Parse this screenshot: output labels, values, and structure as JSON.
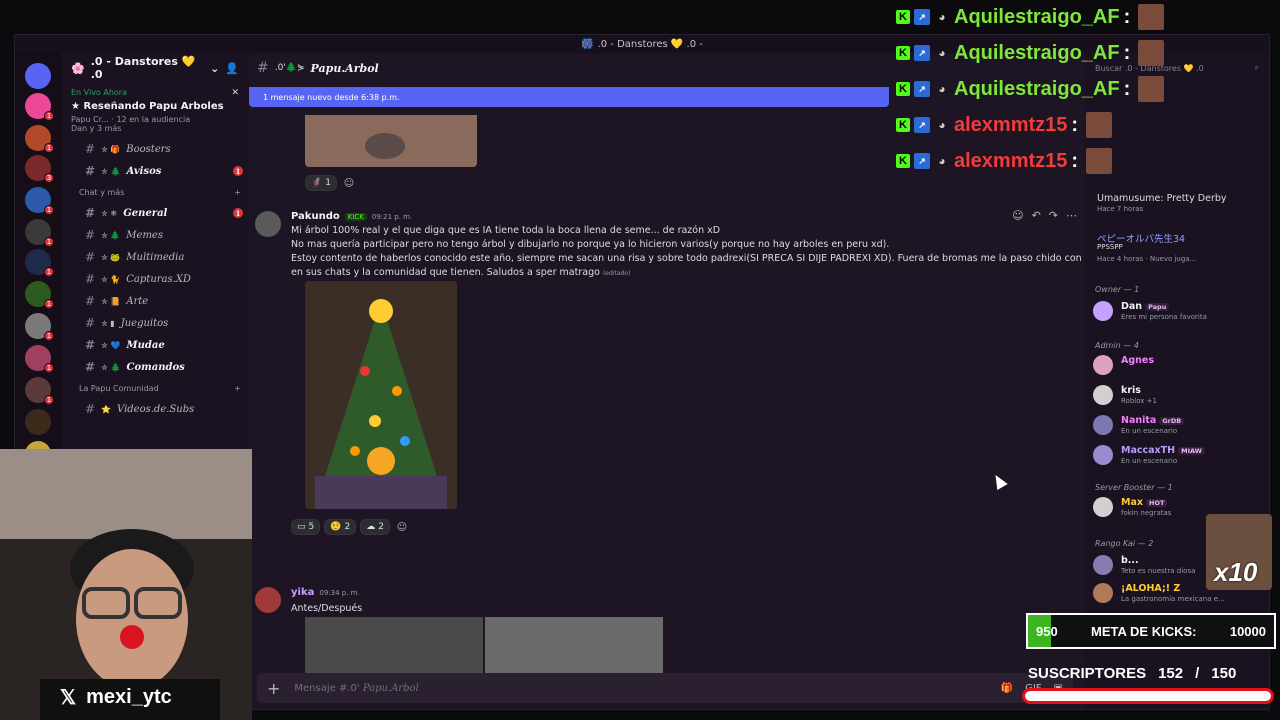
{
  "window": {
    "title": ".0 - Danstores 💛 .0 -"
  },
  "server": {
    "name": ".0 - Danstores 💛 .0",
    "live_label": "En Vivo Ahora",
    "live_title": "Reseñando Papu Arboles",
    "live_host": "Papu Cr...",
    "live_audience": "12 en la audiencia",
    "live_viewers": "Dan y 3 más"
  },
  "server_rail": {
    "badges": [
      "1",
      "1",
      "3",
      "1",
      "1",
      "1",
      "1",
      "1",
      "1",
      "1"
    ]
  },
  "channels": {
    "items": [
      {
        "deco": "✮ 🎁 ",
        "label": "Boosters",
        "bold": false,
        "ping": ""
      },
      {
        "deco": "✮ 🌲 ",
        "label": "Avisos",
        "bold": true,
        "ping": "1"
      }
    ],
    "category1": "Chat y más",
    "chat": [
      {
        "deco": "✮ ❄ ",
        "label": "General",
        "bold": true,
        "ping": "1"
      },
      {
        "deco": "✮ 🌲 ",
        "label": "Memes",
        "bold": false,
        "ping": ""
      },
      {
        "deco": "✮ 🐸 ",
        "label": "Multimedia",
        "bold": false,
        "ping": ""
      },
      {
        "deco": "✮ 🐈 ",
        "label": "Capturas.XD",
        "bold": false,
        "ping": ""
      },
      {
        "deco": "✮ 📙 ",
        "label": "Arte",
        "bold": false,
        "ping": ""
      },
      {
        "deco": "✮ ▮ ",
        "label": "Jueguitos",
        "bold": false,
        "ping": ""
      },
      {
        "deco": "✮ 💙 ",
        "label": "Mudae",
        "bold": true,
        "ping": ""
      },
      {
        "deco": "✮ 🌲 ",
        "label": "Comandos",
        "bold": true,
        "ping": ""
      }
    ],
    "category2": "La Papu Comunidad",
    "community": [
      {
        "deco": "⭐ ",
        "label": "Videos.de.Subs",
        "bold": false,
        "ping": ""
      }
    ]
  },
  "channel": {
    "name": "Papu.Arbol",
    "new_messages": "1 mensaje nuevo desde 6:38 p.m."
  },
  "messages": {
    "top_reaction": "1",
    "pakundo": {
      "author": "Pakundo",
      "badge": "KICK",
      "time": "09:21 p. m.",
      "lines": [
        "Mi árbol 100% real y el que diga que es IA tiene toda la boca llena de seme... de razón xD",
        "No mas quería participar pero no tengo árbol y dibujarlo no porque ya lo hicieron varios(y porque no hay arboles en peru xd).",
        "Estoy contento de haberlos conocido este año, siempre me sacan una risa y sobre todo padrexi(SI PRECA SI DIJE PADREXI XD). Fuera de bromas me la paso chido con ustedes",
        "en sus chats y la comunidad que tienen. Saludos a sper matrago"
      ],
      "edited": "(editado)",
      "reactions": [
        "5",
        "2",
        "2"
      ]
    },
    "yika": {
      "author": "yika",
      "time": "09:34 p. m.",
      "text": "Antes/Después"
    }
  },
  "composer": {
    "placeholder_prefix": "Mensaje #.0'",
    "placeholder_channel": "Papu.Arbol"
  },
  "members": {
    "search": "Buscar .0 - Danstores 💛 .0",
    "activity1_name": "Umamusume: Pretty Derby",
    "activity1_time": "Hace 7 horas",
    "activity2_user": "ペピーオルバ先生34",
    "activity2_text": "PPSSPP",
    "activity2_time": "Hace 4 horas",
    "activity2_extra": "Nuevo juga...",
    "group_owner": "Owner — 1",
    "owner_name": "Dan",
    "owner_tag": "Papu",
    "owner_status": "Eres mi persona favorita",
    "group_admin": "Admin — 4",
    "admins": [
      {
        "name": "Agnes",
        "status": "",
        "color": "#f47fff",
        "tag": ""
      },
      {
        "name": "kris",
        "status": "Roblox +1",
        "color": "#f2f3f5",
        "tag": ""
      },
      {
        "name": "Nanita",
        "status": "En un escenario",
        "color": "#f47fff",
        "tag": "GrDB"
      },
      {
        "name": "MaccaxTH",
        "status": "En un escenario",
        "color": "#b59cff",
        "tag": "MIAW"
      }
    ],
    "group_booster": "Server Booster — 1",
    "booster_name": "Max",
    "booster_tag": "HOT",
    "booster_status": "fokin negratas",
    "group_kai": "Rango Kai — 2",
    "kai1_name": "b...",
    "kai1_status": "Teto es nuestra diosa",
    "kai2_name": "¡ALOHA;! Z",
    "kai2_status": "La gastronomía mexicana e..."
  },
  "stream_chat": [
    {
      "user": "Aquilestraigo_AF",
      "sep": ":",
      "color": "#7ee83a"
    },
    {
      "user": "Aquilestraigo_AF",
      "sep": ":",
      "color": "#7ee83a"
    },
    {
      "user": "Aquilestraigo_AF",
      "sep": ":",
      "color": "#7ee83a"
    },
    {
      "user": "alexmmtz15",
      "sep": ":",
      "color": "#f23b3b"
    },
    {
      "user": "alexmmtz15",
      "sep": ":",
      "color": "#f23b3b"
    }
  ],
  "webcam": {
    "platform_icon": "x-icon",
    "handle": "mexi_ytc"
  },
  "kick_goal": {
    "current": "950",
    "label": "META DE KICKS:",
    "target": "10000",
    "progress": 0.095
  },
  "subs": {
    "label": "SUSCRIPTORES",
    "current": "152",
    "sep": "/",
    "target": "150",
    "progress": 1.0
  },
  "meme_overlay": {
    "multiplier": "x10"
  },
  "colors": {
    "accent": "#5865f2",
    "kick_green": "#53fc18",
    "sub_red": "#e3101a"
  }
}
